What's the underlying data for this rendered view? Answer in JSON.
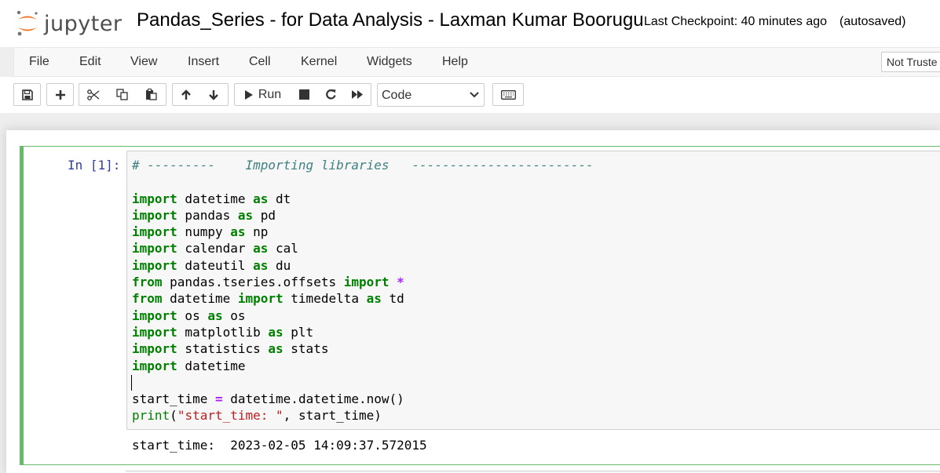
{
  "header": {
    "logo_text": "jupyter",
    "notebook_title": "Pandas_Series - for Data Analysis - Laxman Kumar Boorugu",
    "checkpoint": "Last Checkpoint: 40 minutes ago",
    "autosave_status": "(autosaved)"
  },
  "menu": {
    "items": [
      "File",
      "Edit",
      "View",
      "Insert",
      "Cell",
      "Kernel",
      "Widgets",
      "Help"
    ],
    "trust_status": "Not Truste"
  },
  "toolbar": {
    "run_label": "Run",
    "cell_type": "Code",
    "icons": [
      "save-icon",
      "plus-icon",
      "cut-icon",
      "copy-icon",
      "paste-icon",
      "arrow-up-icon",
      "arrow-down-icon",
      "play-icon",
      "stop-icon",
      "restart-icon",
      "fast-forward-icon",
      "keyboard-icon"
    ]
  },
  "cell": {
    "prompt": "In [1]:",
    "code_lines": [
      [
        {
          "t": "cm",
          "v": "# ---------    Importing libraries   ------------------------"
        }
      ],
      [],
      [
        {
          "t": "kw",
          "v": "import"
        },
        {
          "t": "",
          "v": " datetime "
        },
        {
          "t": "kw",
          "v": "as"
        },
        {
          "t": "",
          "v": " dt"
        }
      ],
      [
        {
          "t": "kw",
          "v": "import"
        },
        {
          "t": "",
          "v": " pandas "
        },
        {
          "t": "kw",
          "v": "as"
        },
        {
          "t": "",
          "v": " pd"
        }
      ],
      [
        {
          "t": "kw",
          "v": "import"
        },
        {
          "t": "",
          "v": " numpy "
        },
        {
          "t": "kw",
          "v": "as"
        },
        {
          "t": "",
          "v": " np"
        }
      ],
      [
        {
          "t": "kw",
          "v": "import"
        },
        {
          "t": "",
          "v": " calendar "
        },
        {
          "t": "kw",
          "v": "as"
        },
        {
          "t": "",
          "v": " cal"
        }
      ],
      [
        {
          "t": "kw",
          "v": "import"
        },
        {
          "t": "",
          "v": " dateutil "
        },
        {
          "t": "kw",
          "v": "as"
        },
        {
          "t": "",
          "v": " du"
        }
      ],
      [
        {
          "t": "kw",
          "v": "from"
        },
        {
          "t": "",
          "v": " pandas.tseries.offsets "
        },
        {
          "t": "kw",
          "v": "import"
        },
        {
          "t": "",
          "v": " "
        },
        {
          "t": "op",
          "v": "*"
        }
      ],
      [
        {
          "t": "kw",
          "v": "from"
        },
        {
          "t": "",
          "v": " datetime "
        },
        {
          "t": "kw",
          "v": "import"
        },
        {
          "t": "",
          "v": " timedelta "
        },
        {
          "t": "kw",
          "v": "as"
        },
        {
          "t": "",
          "v": " td"
        }
      ],
      [
        {
          "t": "kw",
          "v": "import"
        },
        {
          "t": "",
          "v": " os "
        },
        {
          "t": "kw",
          "v": "as"
        },
        {
          "t": "",
          "v": " os"
        }
      ],
      [
        {
          "t": "kw",
          "v": "import"
        },
        {
          "t": "",
          "v": " matplotlib "
        },
        {
          "t": "kw",
          "v": "as"
        },
        {
          "t": "",
          "v": " plt"
        }
      ],
      [
        {
          "t": "kw",
          "v": "import"
        },
        {
          "t": "",
          "v": " statistics "
        },
        {
          "t": "kw",
          "v": "as"
        },
        {
          "t": "",
          "v": " stats"
        }
      ],
      [
        {
          "t": "kw",
          "v": "import"
        },
        {
          "t": "",
          "v": " datetime"
        }
      ],
      [],
      [
        {
          "t": "",
          "v": "start_time "
        },
        {
          "t": "op",
          "v": "="
        },
        {
          "t": "",
          "v": " datetime.datetime.now()"
        }
      ],
      [
        {
          "t": "bi",
          "v": "print"
        },
        {
          "t": "",
          "v": "("
        },
        {
          "t": "st",
          "v": "\"start_time: \""
        },
        {
          "t": "",
          "v": ", start_time)"
        }
      ]
    ],
    "output": "start_time:  2023-02-05 14:09:37.572015"
  }
}
